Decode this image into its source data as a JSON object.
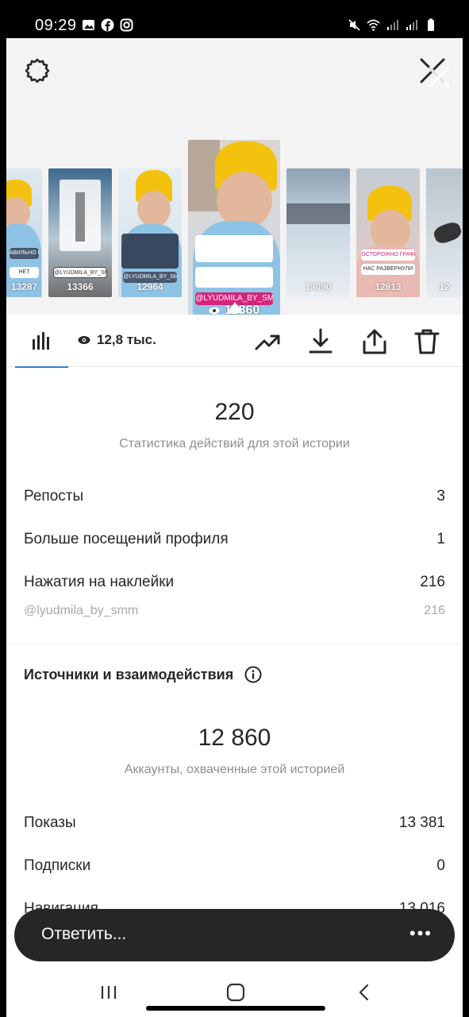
{
  "status_bar": {
    "time": "09:29"
  },
  "thumbnails": [
    {
      "views": "13287",
      "tag": "АВИЛЬНО ПРО",
      "tag2": "НЕТ"
    },
    {
      "views": "13366",
      "tag": "@LYUDMILA_BY_SMM"
    },
    {
      "views": "12964",
      "tag": "@LYUDMILA_BY_SMM"
    },
    {
      "views": "12860",
      "tag": "@LYUDMILA_BY_SMM",
      "selected": true
    },
    {
      "views": "13090"
    },
    {
      "views": "12813",
      "tag": "ОСТОРОЖНО ГРАФИКО!",
      "tag2": "НАС РАЗВЕРНУЛИ"
    },
    {
      "views": "12"
    }
  ],
  "tabbar": {
    "views_label": "12,8 тыс."
  },
  "interactions": {
    "total": "220",
    "label": "Статистика действий для этой истории",
    "rows": [
      {
        "label": "Репосты",
        "value": "3"
      },
      {
        "label": "Больше посещений профиля",
        "value": "1"
      },
      {
        "label": "Нажатия на наклейки",
        "value": "216"
      }
    ],
    "sub_rows": [
      {
        "label": "@lyudmila_by_smm",
        "value": "216"
      }
    ]
  },
  "discovery": {
    "title": "Источники и взаимодействия",
    "total": "12 860",
    "label": "Аккаунты, охваченные этой историей",
    "rows": [
      {
        "label": "Показы",
        "value": "13 381"
      },
      {
        "label": "Подписки",
        "value": "0"
      },
      {
        "label": "Навигация",
        "value": "13 016"
      }
    ]
  },
  "reply": {
    "placeholder": "Ответить...",
    "more": "•••"
  },
  "colors": {
    "accent": "#3a7bd5",
    "reply_bg": "#262626",
    "muted": "#8e8e8e",
    "hat": "#f2c20f",
    "coat": "#8fc3e6",
    "sticker": "#d6247b"
  }
}
